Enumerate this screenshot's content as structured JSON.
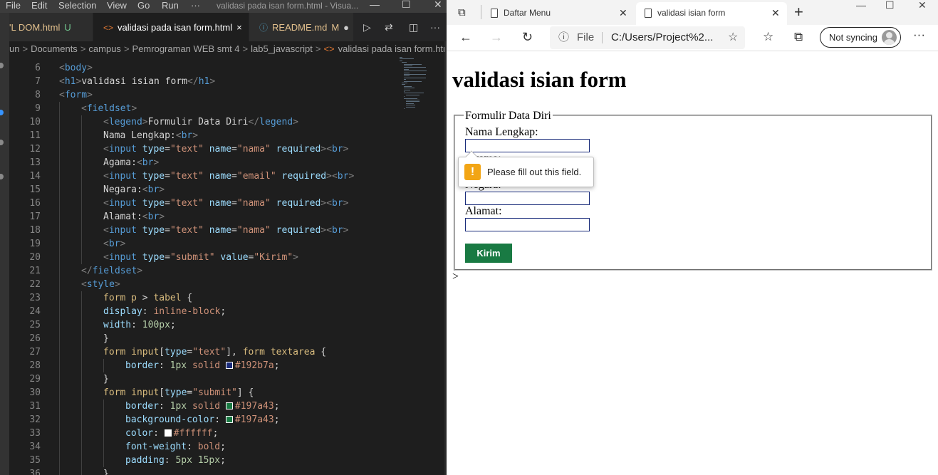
{
  "vscode": {
    "menu": [
      "File",
      "Edit",
      "Selection",
      "View",
      "Go",
      "Run",
      "···"
    ],
    "window_title": "validasi pada isan form.html - Visua...",
    "tabs": [
      {
        "label": "'L DOM.html",
        "status": "U"
      },
      {
        "label": "validasi pada isan form.html",
        "status": "×"
      },
      {
        "label": "README.md",
        "status": "M"
      }
    ],
    "breadcrumb": [
      "un",
      "Documents",
      "campus",
      "Pemrograman WEB smt 4",
      "lab5_javascript",
      "validasi pada isan form.htm"
    ],
    "lines": [
      {
        "n": "6",
        "indent": 0,
        "tokens": [
          [
            "punct",
            "<"
          ],
          [
            "tag",
            "body"
          ],
          [
            "punct",
            ">"
          ]
        ]
      },
      {
        "n": "7",
        "indent": 0,
        "tokens": [
          [
            "punct",
            "<"
          ],
          [
            "tag",
            "h1"
          ],
          [
            "punct",
            ">"
          ],
          [
            "text",
            "validasi isian form"
          ],
          [
            "punct",
            "</"
          ],
          [
            "tag",
            "h1"
          ],
          [
            "punct",
            ">"
          ]
        ]
      },
      {
        "n": "8",
        "indent": 0,
        "tokens": [
          [
            "punct",
            "<"
          ],
          [
            "tag",
            "form"
          ],
          [
            "punct",
            ">"
          ]
        ]
      },
      {
        "n": "9",
        "indent": 1,
        "tokens": [
          [
            "punct",
            "<"
          ],
          [
            "tag",
            "fieldset"
          ],
          [
            "punct",
            ">"
          ]
        ]
      },
      {
        "n": "10",
        "indent": 2,
        "tokens": [
          [
            "punct",
            "<"
          ],
          [
            "tag",
            "legend"
          ],
          [
            "punct",
            ">"
          ],
          [
            "text",
            "Formulir Data Diri"
          ],
          [
            "punct",
            "</"
          ],
          [
            "tag",
            "legend"
          ],
          [
            "punct",
            ">"
          ]
        ]
      },
      {
        "n": "11",
        "indent": 2,
        "tokens": [
          [
            "text",
            "Nama Lengkap:"
          ],
          [
            "punct",
            "<"
          ],
          [
            "tag",
            "br"
          ],
          [
            "punct",
            ">"
          ]
        ]
      },
      {
        "n": "12",
        "indent": 2,
        "tokens": [
          [
            "punct",
            "<"
          ],
          [
            "tag",
            "input"
          ],
          [
            "text",
            " "
          ],
          [
            "attr",
            "type"
          ],
          [
            "text",
            "="
          ],
          [
            "str",
            "\"text\""
          ],
          [
            "text",
            " "
          ],
          [
            "attr",
            "name"
          ],
          [
            "text",
            "="
          ],
          [
            "str",
            "\"nama\""
          ],
          [
            "text",
            " "
          ],
          [
            "attr",
            "required"
          ],
          [
            "punct",
            ">"
          ],
          [
            "punct",
            "<"
          ],
          [
            "tag",
            "br"
          ],
          [
            "punct",
            ">"
          ]
        ]
      },
      {
        "n": "13",
        "indent": 2,
        "tokens": [
          [
            "text",
            "Agama:"
          ],
          [
            "punct",
            "<"
          ],
          [
            "tag",
            "br"
          ],
          [
            "punct",
            ">"
          ]
        ]
      },
      {
        "n": "14",
        "indent": 2,
        "tokens": [
          [
            "punct",
            "<"
          ],
          [
            "tag",
            "input"
          ],
          [
            "text",
            " "
          ],
          [
            "attr",
            "type"
          ],
          [
            "text",
            "="
          ],
          [
            "str",
            "\"text\""
          ],
          [
            "text",
            " "
          ],
          [
            "attr",
            "name"
          ],
          [
            "text",
            "="
          ],
          [
            "str",
            "\"email\""
          ],
          [
            "text",
            " "
          ],
          [
            "attr",
            "required"
          ],
          [
            "punct",
            ">"
          ],
          [
            "punct",
            "<"
          ],
          [
            "tag",
            "br"
          ],
          [
            "punct",
            ">"
          ]
        ]
      },
      {
        "n": "15",
        "indent": 2,
        "tokens": [
          [
            "text",
            "Negara:"
          ],
          [
            "punct",
            "<"
          ],
          [
            "tag",
            "br"
          ],
          [
            "punct",
            ">"
          ]
        ]
      },
      {
        "n": "16",
        "indent": 2,
        "tokens": [
          [
            "punct",
            "<"
          ],
          [
            "tag",
            "input"
          ],
          [
            "text",
            " "
          ],
          [
            "attr",
            "type"
          ],
          [
            "text",
            "="
          ],
          [
            "str",
            "\"text\""
          ],
          [
            "text",
            " "
          ],
          [
            "attr",
            "name"
          ],
          [
            "text",
            "="
          ],
          [
            "str",
            "\"nama\""
          ],
          [
            "text",
            " "
          ],
          [
            "attr",
            "required"
          ],
          [
            "punct",
            ">"
          ],
          [
            "punct",
            "<"
          ],
          [
            "tag",
            "br"
          ],
          [
            "punct",
            ">"
          ]
        ]
      },
      {
        "n": "17",
        "indent": 2,
        "tokens": [
          [
            "text",
            "Alamat:"
          ],
          [
            "punct",
            "<"
          ],
          [
            "tag",
            "br"
          ],
          [
            "punct",
            ">"
          ]
        ]
      },
      {
        "n": "18",
        "indent": 2,
        "tokens": [
          [
            "punct",
            "<"
          ],
          [
            "tag",
            "input"
          ],
          [
            "text",
            " "
          ],
          [
            "attr",
            "type"
          ],
          [
            "text",
            "="
          ],
          [
            "str",
            "\"text\""
          ],
          [
            "text",
            " "
          ],
          [
            "attr",
            "name"
          ],
          [
            "text",
            "="
          ],
          [
            "str",
            "\"nama\""
          ],
          [
            "text",
            " "
          ],
          [
            "attr",
            "required"
          ],
          [
            "punct",
            ">"
          ],
          [
            "punct",
            "<"
          ],
          [
            "tag",
            "br"
          ],
          [
            "punct",
            ">"
          ]
        ]
      },
      {
        "n": "19",
        "indent": 2,
        "tokens": [
          [
            "punct",
            "<"
          ],
          [
            "tag",
            "br"
          ],
          [
            "punct",
            ">"
          ]
        ]
      },
      {
        "n": "20",
        "indent": 2,
        "tokens": [
          [
            "punct",
            "<"
          ],
          [
            "tag",
            "input"
          ],
          [
            "text",
            " "
          ],
          [
            "attr",
            "type"
          ],
          [
            "text",
            "="
          ],
          [
            "str",
            "\"submit\""
          ],
          [
            "text",
            " "
          ],
          [
            "attr",
            "value"
          ],
          [
            "text",
            "="
          ],
          [
            "str",
            "\"Kirim\""
          ],
          [
            "punct",
            ">"
          ]
        ]
      },
      {
        "n": "21",
        "indent": 1,
        "tokens": [
          [
            "punct",
            "</"
          ],
          [
            "tag",
            "fieldset"
          ],
          [
            "punct",
            ">"
          ]
        ]
      },
      {
        "n": "22",
        "indent": 1,
        "tokens": [
          [
            "punct",
            "<"
          ],
          [
            "tag",
            "style"
          ],
          [
            "punct",
            ">"
          ]
        ]
      },
      {
        "n": "23",
        "indent": 2,
        "tokens": [
          [
            "sel",
            "form p"
          ],
          [
            "text",
            " > "
          ],
          [
            "sel",
            "tabel"
          ],
          [
            "text",
            " {"
          ]
        ]
      },
      {
        "n": "24",
        "indent": 2,
        "tokens": [
          [
            "prop",
            "display"
          ],
          [
            "text",
            ": "
          ],
          [
            "str",
            "inline-block"
          ],
          [
            "text",
            ";"
          ]
        ]
      },
      {
        "n": "25",
        "indent": 2,
        "tokens": [
          [
            "prop",
            "width"
          ],
          [
            "text",
            ": "
          ],
          [
            "num",
            "100px"
          ],
          [
            "text",
            ";"
          ]
        ]
      },
      {
        "n": "26",
        "indent": 2,
        "tokens": [
          [
            "text",
            "}"
          ]
        ]
      },
      {
        "n": "27",
        "indent": 2,
        "tokens": [
          [
            "sel",
            "form input"
          ],
          [
            "text",
            "["
          ],
          [
            "prop",
            "type"
          ],
          [
            "text",
            "="
          ],
          [
            "str",
            "\"text\""
          ],
          [
            "text",
            "], "
          ],
          [
            "sel",
            "form textarea"
          ],
          [
            "text",
            " {"
          ]
        ]
      },
      {
        "n": "28",
        "indent": 3,
        "tokens": [
          [
            "prop",
            "border"
          ],
          [
            "text",
            ": "
          ],
          [
            "num",
            "1px"
          ],
          [
            "text",
            " "
          ],
          [
            "str",
            "solid"
          ],
          [
            "text",
            " "
          ],
          [
            "swatch",
            "#192b7a"
          ],
          [
            "str",
            "#192b7a"
          ],
          [
            "text",
            ";"
          ]
        ]
      },
      {
        "n": "29",
        "indent": 2,
        "tokens": [
          [
            "text",
            "}"
          ]
        ]
      },
      {
        "n": "30",
        "indent": 2,
        "tokens": [
          [
            "sel",
            "form input"
          ],
          [
            "text",
            "["
          ],
          [
            "prop",
            "type"
          ],
          [
            "text",
            "="
          ],
          [
            "str",
            "\"submit\""
          ],
          [
            "text",
            "] {"
          ]
        ]
      },
      {
        "n": "31",
        "indent": 3,
        "tokens": [
          [
            "prop",
            "border"
          ],
          [
            "text",
            ": "
          ],
          [
            "num",
            "1px"
          ],
          [
            "text",
            " "
          ],
          [
            "str",
            "solid"
          ],
          [
            "text",
            " "
          ],
          [
            "swatch",
            "#197a43"
          ],
          [
            "str",
            "#197a43"
          ],
          [
            "text",
            ";"
          ]
        ]
      },
      {
        "n": "32",
        "indent": 3,
        "tokens": [
          [
            "prop",
            "background-color"
          ],
          [
            "text",
            ": "
          ],
          [
            "swatch",
            "#197a43"
          ],
          [
            "str",
            "#197a43"
          ],
          [
            "text",
            ";"
          ]
        ]
      },
      {
        "n": "33",
        "indent": 3,
        "tokens": [
          [
            "prop",
            "color"
          ],
          [
            "text",
            ": "
          ],
          [
            "swatch",
            "#ffffff"
          ],
          [
            "str",
            "#ffffff"
          ],
          [
            "text",
            ";"
          ]
        ]
      },
      {
        "n": "34",
        "indent": 3,
        "tokens": [
          [
            "prop",
            "font-weight"
          ],
          [
            "text",
            ": "
          ],
          [
            "str",
            "bold"
          ],
          [
            "text",
            ";"
          ]
        ]
      },
      {
        "n": "35",
        "indent": 3,
        "tokens": [
          [
            "prop",
            "padding"
          ],
          [
            "text",
            ": "
          ],
          [
            "num",
            "5px 15px"
          ],
          [
            "text",
            ";"
          ]
        ]
      },
      {
        "n": "36",
        "indent": 2,
        "tokens": [
          [
            "text",
            "}"
          ]
        ]
      }
    ]
  },
  "browser": {
    "tabs": [
      {
        "label": "Daftar Menu",
        "active": false
      },
      {
        "label": "validasi isian form",
        "active": true
      }
    ],
    "address": {
      "scheme": "File",
      "url": "C:/Users/Project%2..."
    },
    "sync_label": "Not syncing",
    "page": {
      "title": "validasi isian form",
      "legend": "Formulir Data Diri",
      "fields": [
        {
          "label": "Nama Lengkap:",
          "value": ""
        },
        {
          "label": "Agama:",
          "value": ""
        },
        {
          "label": "Negara:",
          "value": ""
        },
        {
          "label": "Alamat:",
          "value": ""
        }
      ],
      "submit_label": "Kirim",
      "stray_text": ">",
      "validation_message": "Please fill out this field."
    }
  },
  "colors": {
    "input_border": "#192b7a",
    "submit_bg": "#197a43",
    "submit_text": "#ffffff",
    "vscode_bg": "#1e1e1e",
    "warn": "#f2a515"
  }
}
